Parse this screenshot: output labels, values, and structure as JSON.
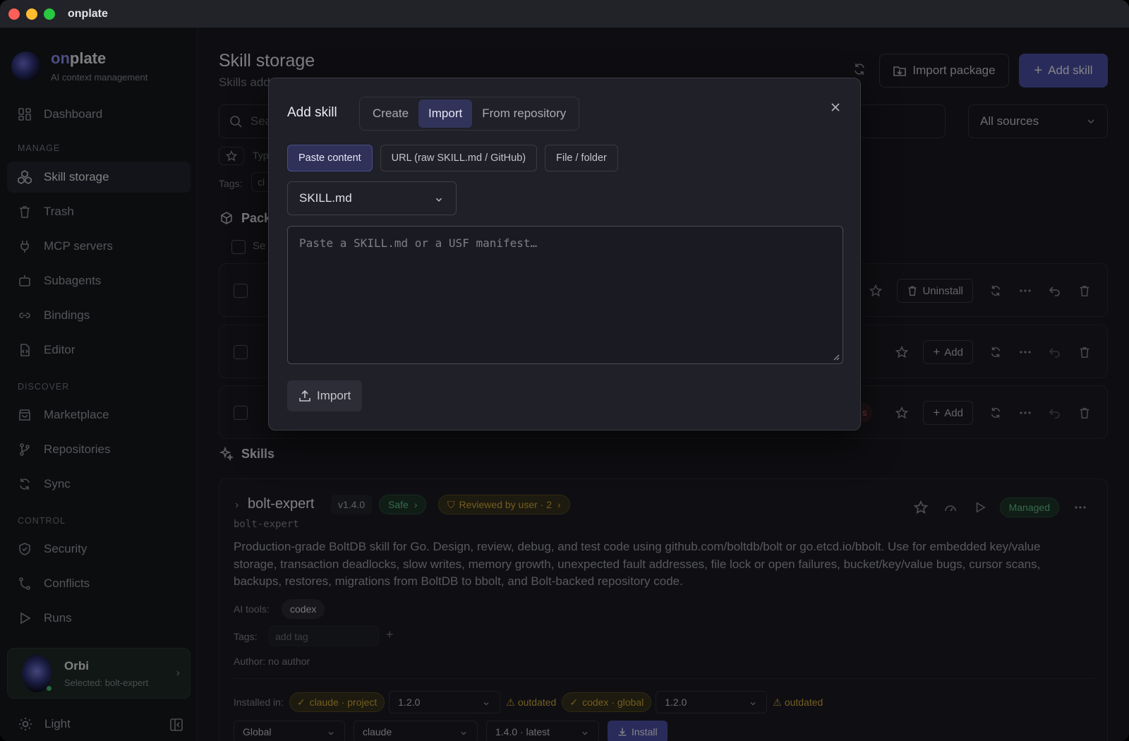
{
  "app": {
    "title": "onplate",
    "brand_name_accent": "on",
    "brand_name_rest": "plate",
    "brand_subtitle": "AI context management"
  },
  "sidebar": {
    "items": [
      {
        "label": "Dashboard",
        "icon": "dashboard-icon"
      },
      {
        "label": "Skill storage",
        "icon": "skills-icon",
        "active": true
      },
      {
        "label": "Trash",
        "icon": "trash-icon"
      },
      {
        "label": "MCP servers",
        "icon": "plug-icon"
      },
      {
        "label": "Subagents",
        "icon": "robot-icon"
      },
      {
        "label": "Bindings",
        "icon": "link-icon"
      },
      {
        "label": "Editor",
        "icon": "file-code-icon"
      },
      {
        "label": "Marketplace",
        "icon": "store-icon"
      },
      {
        "label": "Repositories",
        "icon": "git-branch-icon"
      },
      {
        "label": "Sync",
        "icon": "sync-icon"
      },
      {
        "label": "Security",
        "icon": "shield-icon"
      },
      {
        "label": "Conflicts",
        "icon": "merge-icon"
      },
      {
        "label": "Runs",
        "icon": "play-icon"
      }
    ],
    "sections": {
      "manage": "MANAGE",
      "discover": "DISCOVER",
      "control": "CONTROL"
    },
    "orbi": {
      "name": "Orbi",
      "selected": "Selected: bolt-expert"
    },
    "theme_label": "Light"
  },
  "main": {
    "title": "Skill storage",
    "subtitle": "Skills add",
    "import_package_label": "Import package",
    "add_skill_label": "Add skill",
    "search_placeholder": "Sea",
    "sources_select": "All sources",
    "type_label": "Typ",
    "tags_label": "Tags:",
    "tags_chip": "cl",
    "packages_heading": "Pack",
    "select_all_label": "Se",
    "skills_heading": "Skills",
    "row_actions": {
      "uninstall": "Uninstall",
      "add": "Add"
    },
    "partial_pill": "s"
  },
  "skill": {
    "name": "bolt-expert",
    "version": "v1.4.0",
    "safe": "Safe",
    "review": "Reviewed by user · 2",
    "id": "bolt-expert",
    "description": "Production-grade BoltDB skill for Go. Design, review, debug, and test code using github.com/boltdb/bolt or go.etcd.io/bbolt. Use for embedded key/value storage, transaction deadlocks, slow writes, memory growth, unexpected fault addresses, file lock or open failures, bucket/key/value bugs, cursor scans, backups, restores, migrations from BoltDB to bbolt, and Bolt-backed repository code.",
    "ai_tools_label": "AI tools:",
    "ai_tool": "codex",
    "tags_label": "Tags:",
    "tag_placeholder": "add tag",
    "author": "Author: no author",
    "managed": "Managed",
    "installed_in_label": "Installed in:",
    "installs": [
      {
        "env": "claude · project",
        "version": "1.2.0",
        "status": "outdated"
      },
      {
        "env": "codex · global",
        "version": "1.2.0",
        "status": "outdated"
      }
    ],
    "scope_select": "Global",
    "tool_select": "claude",
    "version_select": "1.4.0 · latest",
    "install_label": "Install"
  },
  "modal": {
    "title": "Add skill",
    "tabs": [
      "Create",
      "Import",
      "From repository"
    ],
    "active_tab": "Import",
    "source_buttons": [
      "Paste content",
      "URL (raw SKILL.md / GitHub)",
      "File / folder"
    ],
    "format_select": "SKILL.md",
    "paste_placeholder": "Paste a SKILL.md or a USF manifest…",
    "import_button": "Import"
  }
}
